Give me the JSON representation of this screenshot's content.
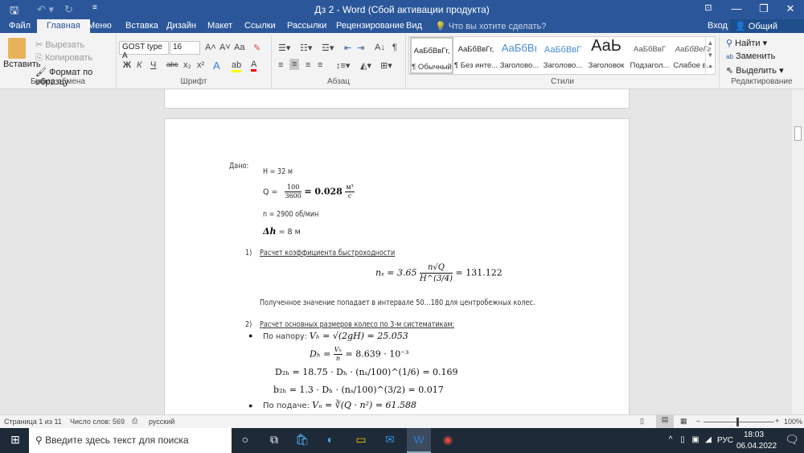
{
  "titlebar": {
    "title": "Дз 2 - Word (Сбой активации продукта)",
    "save_icon": "save-icon",
    "undo_icon": "undo-icon",
    "redo_icon": "redo-icon"
  },
  "tabs": [
    {
      "label": "Файл"
    },
    {
      "label": "Главная"
    },
    {
      "label": "Меню"
    },
    {
      "label": "Вставка"
    },
    {
      "label": "Дизайн"
    },
    {
      "label": "Макет"
    },
    {
      "label": "Ссылки"
    },
    {
      "label": "Рассылки"
    },
    {
      "label": "Рецензирование"
    },
    {
      "label": "Вид"
    }
  ],
  "tellme": "Что вы хотите сделать?",
  "signin": "Вход",
  "share": "Общий доступ",
  "clipboard": {
    "paste": "Вставить",
    "cut": "Вырезать",
    "copy": "Копировать",
    "format_painter": "Формат по образцу",
    "label": "Буфер обмена"
  },
  "font": {
    "name": "GOST type A",
    "size": "16",
    "label": "Шрифт",
    "bold": "Ж",
    "italic": "К",
    "underline": "Ч",
    "aa": "Aa"
  },
  "paragraph": {
    "label": "Абзац"
  },
  "styles": {
    "label": "Стили",
    "items": [
      {
        "preview": "АаБбВвГг,",
        "name": "¶ Обычный"
      },
      {
        "preview": "АаБбВвГг,",
        "name": "¶ Без инте..."
      },
      {
        "preview": "АаБбВı",
        "name": "Заголово..."
      },
      {
        "preview": "АаБбВвГ",
        "name": "Заголово..."
      },
      {
        "preview": "АаЬ",
        "name": "Заголовок"
      },
      {
        "preview": "АаБбВвГ",
        "name": "Подзагол..."
      },
      {
        "preview": "АаБбВеГг",
        "name": "Слабое в..."
      }
    ]
  },
  "editing": {
    "find": "Найти",
    "replace": "Заменить",
    "select": "Выделить",
    "label": "Редактирование"
  },
  "doc": {
    "given_label": "Дано:",
    "H": "H = 32 м",
    "Q_prefix": "Q = ",
    "Q_num": "100",
    "Q_den": "3600",
    "Q_val": "= 0.028",
    "Q_unit_num": "м³",
    "Q_unit_den": "с",
    "n": "n = 2900 об/мин",
    "dh_sym": "Δh",
    "dh": " = 8 м",
    "s1_num": "1)",
    "s1_title": "Расчет коэффициента быстроходности",
    "ns_lhs": "nₛ = 3.65",
    "ns_num": "n√Q",
    "ns_den": "H^(3/4)",
    "ns_rhs": "= 131.122",
    "s1_note": "Полученное значение попадает в интервале 50…180 для центробежных колес.",
    "s2_num": "2)",
    "s2_title": "Расчет основных размеров колесо по 3-м систематикам:",
    "b1_label": "По напору: ",
    "b1_formula": "Vₕ = √(2gH) = 25.053",
    "Dh_lhs": "Dₕ = ",
    "Dh_num": "Vₕ",
    "Dh_den": "n",
    "Dh_rhs": "= 8.639 · 10⁻³",
    "D2h": "D₂ₕ = 18.75 · Dₕ · (nₛ/100)^(1/6) = 0.169",
    "b2h": "b₂ₕ = 1.3 · Dₕ · (nₛ/100)^(3/2) = 0.017",
    "b2_label": "По подаче: ",
    "b2_formula": "Vₙ = ∛(Q · n²) = 61.588"
  },
  "status": {
    "page": "Страница 1 из 11",
    "words": "Число слов: 569",
    "lang": "русский",
    "zoom": "100%",
    "zoom_percent": 100
  },
  "taskbar": {
    "search_placeholder": "Введите здесь текст для поиска",
    "lang": "РУС",
    "time": "18:03",
    "date": "06.04.2022"
  }
}
